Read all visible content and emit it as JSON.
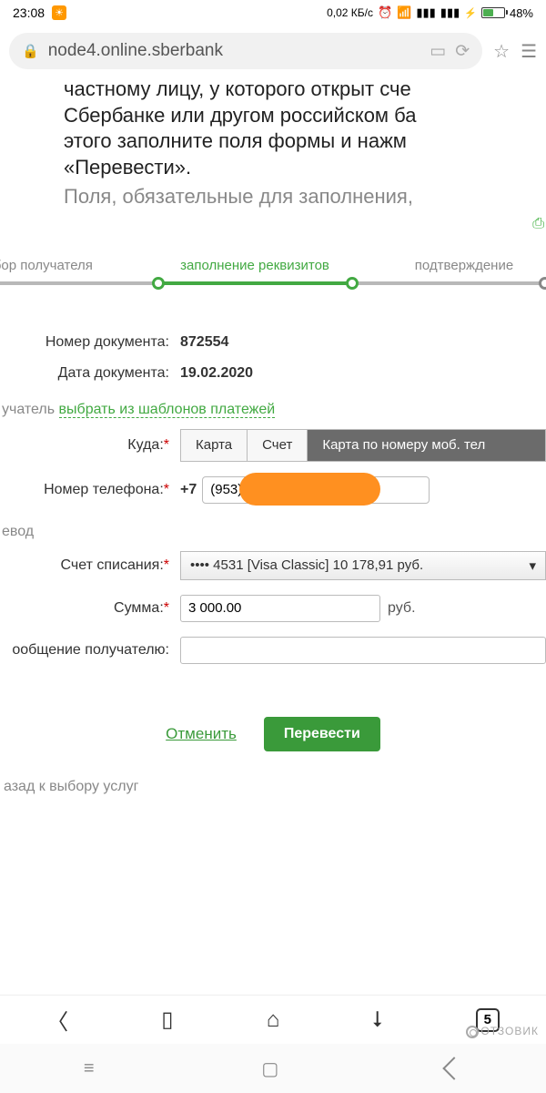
{
  "status": {
    "time": "23:08",
    "speed": "0,02 КБ/с",
    "battery_pct": "48%"
  },
  "address": {
    "url": "node4.online.sberbank"
  },
  "intro": {
    "line1": "частному лицу, у которого открыт сче",
    "line2": "Сбербанке или другом российском ба",
    "line3": "этого заполните поля формы и нажм",
    "line4": "«Перевести».",
    "sub": "Поля, обязательные для заполнения,"
  },
  "steps": {
    "s1": "выбор получателя",
    "s2": "заполнение реквизитов",
    "s3": "подтверждение"
  },
  "form": {
    "doc_num_label": "Номер документа:",
    "doc_num": "872554",
    "doc_date_label": "Дата документа:",
    "doc_date": "19.02.2020",
    "recipient_label": "учатель",
    "template_link": "выбрать из шаблонов платежей",
    "dest_label": "Куда:",
    "tabs": {
      "card": "Карта",
      "account": "Счет",
      "mobile": "Карта по номеру моб. тел"
    },
    "phone_label": "Номер телефона:",
    "phone_prefix": "+7",
    "phone_value": "(953)",
    "transfer_section": "евод",
    "account_label": "Счет списания:",
    "account_value": "•••• 4531 [Visa Classic] 10 178,91 руб.",
    "amount_label": "Сумма:",
    "amount_value": "3 000.00",
    "currency": "руб.",
    "msg_label": "ообщение получателю:"
  },
  "actions": {
    "cancel": "Отменить",
    "submit": "Перевести"
  },
  "back_link": "азад к выбору услуг",
  "tabs_count": "5",
  "watermark": "ОТЗОВИК"
}
